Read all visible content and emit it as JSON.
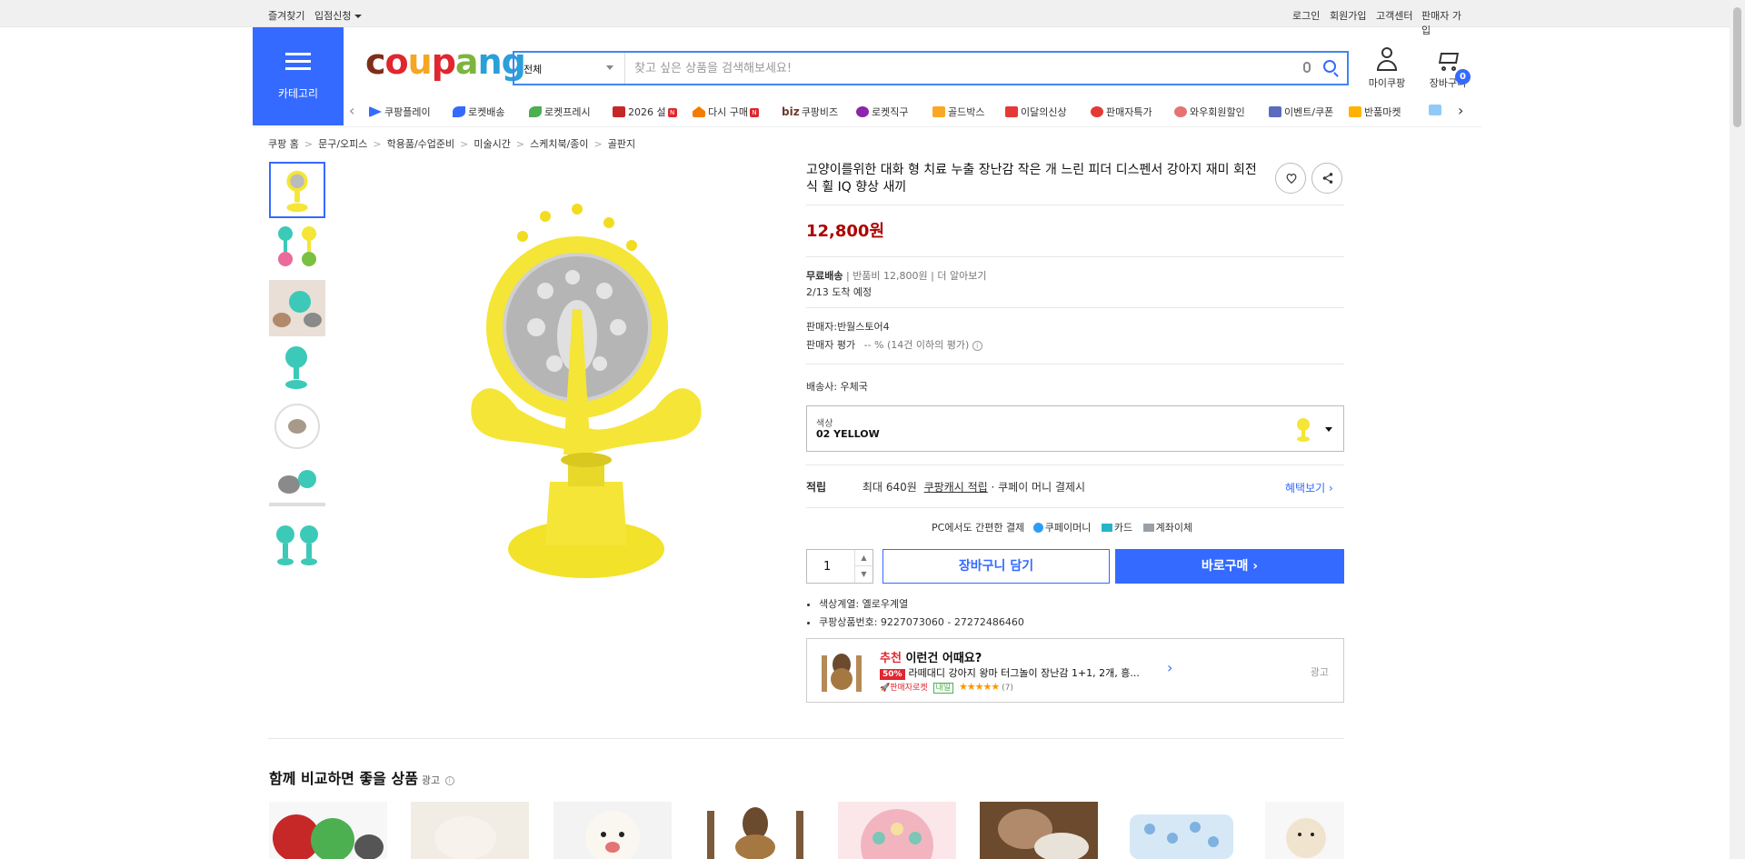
{
  "topbar": {
    "left": [
      "즐겨찾기",
      "입점신청"
    ],
    "right": [
      "로그인",
      "회원가입",
      "고객센터",
      "판매자 가입"
    ]
  },
  "header": {
    "category_label": "카테고리",
    "logo": "coupang",
    "search_category": "전체",
    "search_placeholder": "찾고 싶은 상품을 검색해보세요!",
    "mycoupang": "마이쿠팡",
    "cart": "장바구니",
    "cart_count": "0"
  },
  "nav": [
    "쿠팡플레이",
    "로켓배송",
    "로켓프레시",
    "2026 설",
    "다시 구매",
    "쿠팡비즈",
    "로켓직구",
    "골드박스",
    "이달의신상",
    "판매자특가",
    "와우회원할인",
    "이벤트/쿠폰",
    "반품마켓"
  ],
  "nav_biz_prefix": "biz",
  "breadcrumb": [
    "쿠팡 홈",
    "문구/오피스",
    "학용품/수업준비",
    "미술시간",
    "스케치북/종이",
    "골판지"
  ],
  "product": {
    "title": "고양이를위한 대화 형 치료 누출 장난감 작은 개 느린 피더 디스펜서 강아지 재미 회전식 휠 IQ 향상 새끼",
    "price": "12,800원",
    "shipping": "무료배송",
    "return_fee": "반품비 12,800원",
    "more": "더 알아보기",
    "arrival": "2/13 도착 예정",
    "seller": "판매자:반월스토어4",
    "seller_rating_label": "판매자 평가",
    "seller_rating_value": "-- % (14건 이하의 평가)",
    "carrier": "배송사:  우체국",
    "option_label": "색상",
    "option_value": "02 YELLOW",
    "reward_label": "적립",
    "reward_text": "최대 640원",
    "reward_link": "쿠팡캐시 적립",
    "reward_suffix": "· 쿠페이 머니 결제시",
    "benefit_link": "혜택보기",
    "pay_title": "PC에서도 간편한 결제",
    "pay_methods": [
      "쿠페이머니",
      "카드",
      "계좌이체"
    ],
    "quantity": "1",
    "add_cart": "장바구니 담기",
    "buy_now": "바로구매",
    "bullets": [
      "색상계열: 옐로우계열",
      "쿠팡상품번호: 9227073060 - 27272486460"
    ]
  },
  "recommend": {
    "title_highlight": "추천",
    "title_rest": " 이런건 어때요?",
    "discount": "50%",
    "name": "라떼대디 강아지 왕마 터그놀이 장난감 1+1, 2개, 흥...",
    "rocket": "판매자로켓",
    "tag": "내일",
    "stars": "★★★★★",
    "reviews": "(7)",
    "ad": "광고"
  },
  "compare": {
    "title": "함께 비교하면 좋을 상품",
    "ad": "광고"
  },
  "colors": {
    "brand_blue": "#346aff",
    "price_red": "#ae0000",
    "badge_red": "#e0262f"
  }
}
